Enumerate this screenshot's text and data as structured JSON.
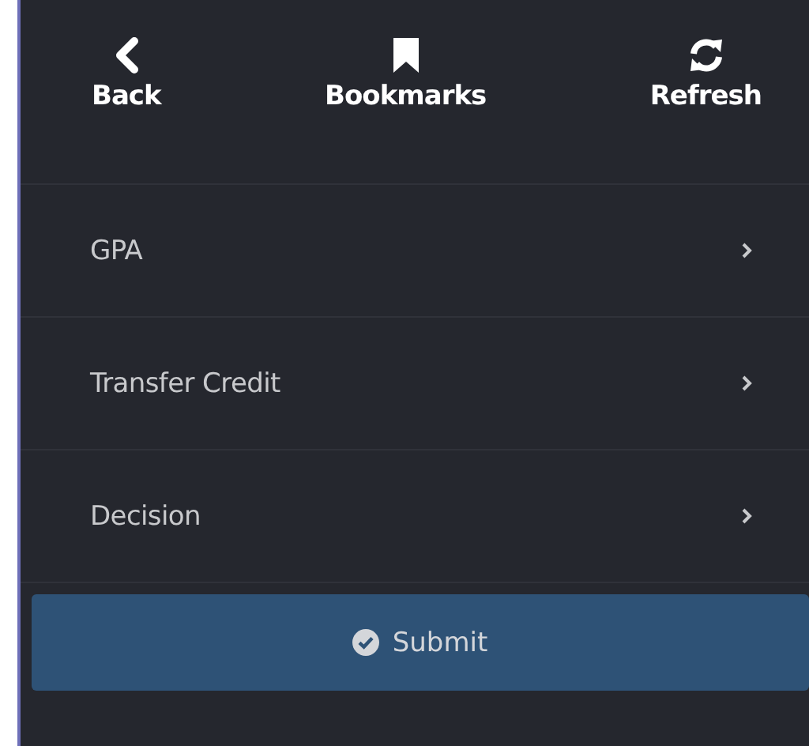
{
  "toolbar": [
    {
      "label": "Back"
    },
    {
      "label": "Bookmarks"
    },
    {
      "label": "Refresh"
    }
  ],
  "menu": [
    {
      "label": "GPA"
    },
    {
      "label": "Transfer Credit"
    },
    {
      "label": "Decision"
    }
  ],
  "submit": {
    "label": "Submit"
  }
}
